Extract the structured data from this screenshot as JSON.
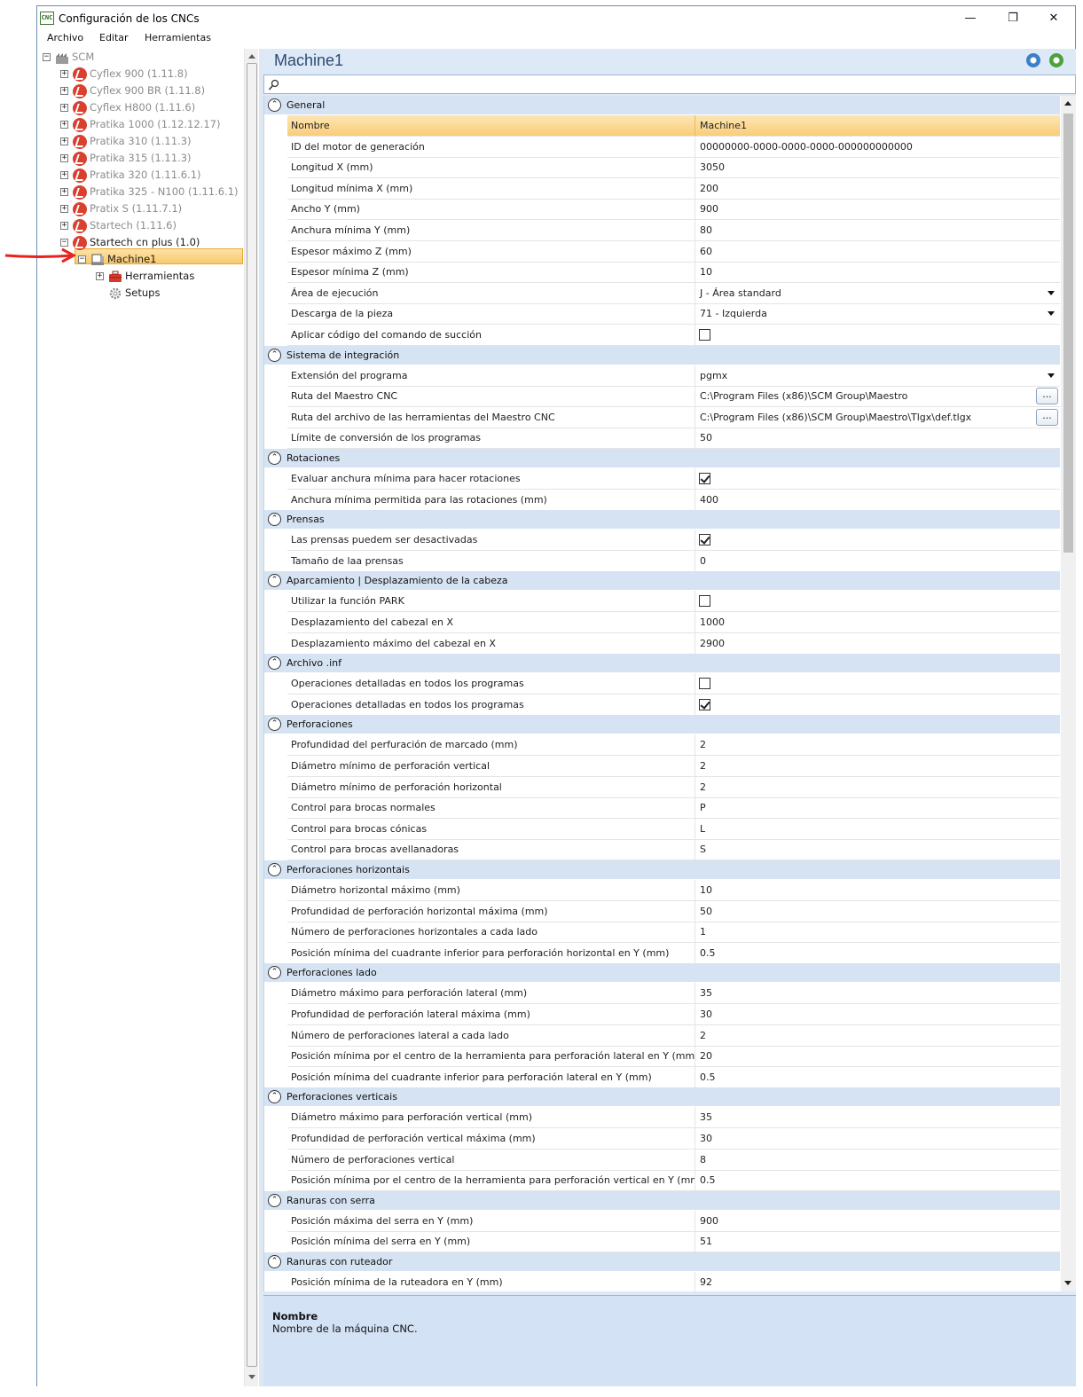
{
  "window": {
    "title": "Configuración de los CNCs",
    "icon_text": "CNC",
    "controls": {
      "minimize": "—",
      "maximize": "❐",
      "close": "✕"
    }
  },
  "menu": [
    "Archivo",
    "Editar",
    "Herramientas"
  ],
  "tree": {
    "root": "SCM",
    "machines": [
      "Cyflex 900 (1.11.8)",
      "Cyflex 900 BR (1.11.8)",
      "Cyflex H800 (1.11.6)",
      "Pratika 1000 (1.12.12.17)",
      "Pratika 310 (1.11.3)",
      "Pratika 315 (1.11.3)",
      "Pratika 320 (1.11.6.1)",
      "Pratika 325 - N100 (1.11.6.1)",
      "Pratix S (1.11.7.1)",
      "Startech (1.11.6)",
      "Startech cn plus (1.0)"
    ],
    "selected": "Machine1",
    "children": [
      "Herramientas",
      "Setups"
    ]
  },
  "panel": {
    "title": "Machine1",
    "search_placeholder": ""
  },
  "categories": [
    {
      "name": "General",
      "rows": [
        {
          "name": "Nombre",
          "value": "Machine1",
          "selected": true
        },
        {
          "name": "ID del motor de generación",
          "value": "00000000-0000-0000-0000-000000000000"
        },
        {
          "name": "Longitud X (mm)",
          "value": "3050"
        },
        {
          "name": "Longitud mínima X (mm)",
          "value": "200"
        },
        {
          "name": "Ancho Y (mm)",
          "value": "900"
        },
        {
          "name": "Anchura mínima Y (mm)",
          "value": "80"
        },
        {
          "name": "Espesor máximo Z (mm)",
          "value": "60"
        },
        {
          "name": "Espesor mínima Z (mm)",
          "value": "10"
        },
        {
          "name": "Área de ejecución",
          "value": "J - Área standard",
          "dropdown": true
        },
        {
          "name": "Descarga de la pieza",
          "value": "71 - Izquierda",
          "dropdown": true
        },
        {
          "name": "Aplicar código del comando de succión",
          "check": false
        }
      ]
    },
    {
      "name": "Sistema de integración",
      "rows": [
        {
          "name": "Extensión del programa",
          "value": "pgmx",
          "dropdown": true
        },
        {
          "name": "Ruta del Maestro CNC",
          "value": "C:\\Program Files (x86)\\SCM Group\\Maestro",
          "ellipsis": "..."
        },
        {
          "name": "Ruta del archivo de las herramientas del Maestro CNC",
          "value": "C:\\Program Files (x86)\\SCM Group\\Maestro\\Tlgx\\def.tlgx",
          "ellipsis": "..."
        },
        {
          "name": "Límite de conversión de los programas",
          "value": "50"
        }
      ]
    },
    {
      "name": "Rotaciones",
      "rows": [
        {
          "name": "Evaluar anchura mínima para hacer rotaciones",
          "check": true
        },
        {
          "name": "Anchura mínima permitida para las rotaciones (mm)",
          "value": "400"
        }
      ]
    },
    {
      "name": "Prensas",
      "rows": [
        {
          "name": "Las prensas puedem ser desactivadas",
          "check": true
        },
        {
          "name": "Tamaño de laa prensas",
          "value": "0"
        }
      ]
    },
    {
      "name": "Aparcamiento | Desplazamiento de la cabeza",
      "rows": [
        {
          "name": "Utilizar la función PARK",
          "check": false
        },
        {
          "name": "Desplazamiento del cabezal en X",
          "value": "1000"
        },
        {
          "name": "Desplazamiento máximo del cabezal en X",
          "value": "2900"
        }
      ]
    },
    {
      "name": "Archivo .inf",
      "rows": [
        {
          "name": "Operaciones detalladas en todos los programas",
          "check": false
        },
        {
          "name": "Operaciones detalladas en todos los programas",
          "check": true
        }
      ]
    },
    {
      "name": "Perforaciones",
      "rows": [
        {
          "name": "Profundidad del perfuración de marcado (mm)",
          "value": "2"
        },
        {
          "name": "Diámetro mínimo de perforación vertical",
          "value": "2"
        },
        {
          "name": "Diámetro mínimo de perforación horizontal",
          "value": "2"
        },
        {
          "name": "Control para brocas normales",
          "value": "P"
        },
        {
          "name": "Control para brocas cónicas",
          "value": "L"
        },
        {
          "name": "Control para brocas avellanadoras",
          "value": "S"
        }
      ]
    },
    {
      "name": "Perforaciones horizontais",
      "rows": [
        {
          "name": "Diámetro horizontal máximo (mm)",
          "value": "10"
        },
        {
          "name": "Profundidad de perforación horizontal máxima (mm)",
          "value": "50"
        },
        {
          "name": "Número de perforaciones horizontales a cada lado",
          "value": "1"
        },
        {
          "name": "Posición mínima del cuadrante inferior para perforación horizontal en Y (mm)",
          "value": "0.5"
        }
      ]
    },
    {
      "name": "Perforaciones lado",
      "rows": [
        {
          "name": "Diámetro máximo para perforación lateral (mm)",
          "value": "35"
        },
        {
          "name": "Profundidad de perforación lateral máxima (mm)",
          "value": "30"
        },
        {
          "name": "Número de perforaciones lateral a cada lado",
          "value": "2"
        },
        {
          "name": "Posición mínima por el centro de la herramienta para perforación lateral en Y (mm)",
          "value": "20"
        },
        {
          "name": "Posición mínima del cuadrante inferior para perforación lateral en Y (mm)",
          "value": "0.5"
        }
      ]
    },
    {
      "name": "Perforaciones verticais",
      "rows": [
        {
          "name": "Diámetro máximo para perforación vertical (mm)",
          "value": "35"
        },
        {
          "name": "Profundidad de perforación vertical máxima (mm)",
          "value": "30"
        },
        {
          "name": "Número de perforaciones vertical",
          "value": "8"
        },
        {
          "name": "Posición mínima por el centro de la herramienta para perforación vertical en Y (mm)",
          "value": "0.5"
        }
      ]
    },
    {
      "name": "Ranuras con serra",
      "rows": [
        {
          "name": "Posición máxima del serra en Y (mm)",
          "value": "900"
        },
        {
          "name": "Posición mínima del serra en Y (mm)",
          "value": "51"
        }
      ]
    },
    {
      "name": "Ranuras con ruteador",
      "rows": [
        {
          "name": "Posición mínima de la ruteadora en Y (mm)",
          "value": "92"
        }
      ]
    }
  ],
  "description": {
    "title": "Nombre",
    "text": "Nombre de la máquina CNC."
  },
  "colors": {
    "accent": "#2b4a72",
    "selection": "#f9cd79",
    "category": "#d6e3f2",
    "panel": "#dde9f6"
  }
}
